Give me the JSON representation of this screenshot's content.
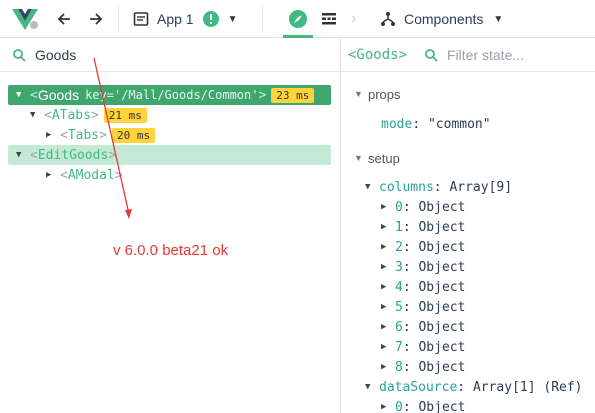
{
  "toolbar": {
    "app_label": "App 1",
    "components_label": "Components"
  },
  "tree": {
    "search_value": "Goods",
    "nodes": [
      {
        "name": "Goods",
        "attr": "key='/Mall/Goods/Common'",
        "time": "23 ms"
      },
      {
        "name": "ATabs",
        "time": "21 ms"
      },
      {
        "name": "Tabs",
        "time": "20 ms"
      },
      {
        "name": "EditGoods"
      },
      {
        "name": "AModal"
      }
    ]
  },
  "inspector": {
    "component_name": "<Goods>",
    "filter_placeholder": "Filter state...",
    "props_label": "props",
    "prop_mode_key": "mode",
    "prop_mode_value": "\"common\"",
    "setup_label": "setup",
    "columns_key": "columns",
    "columns_value": "Array[9]",
    "columns_items": [
      {
        "key": "0",
        "value": "Object"
      },
      {
        "key": "1",
        "value": "Object"
      },
      {
        "key": "2",
        "value": "Object"
      },
      {
        "key": "3",
        "value": "Object"
      },
      {
        "key": "4",
        "value": "Object"
      },
      {
        "key": "5",
        "value": "Object"
      },
      {
        "key": "6",
        "value": "Object"
      },
      {
        "key": "7",
        "value": "Object"
      },
      {
        "key": "8",
        "value": "Object"
      }
    ],
    "datasource_key": "dataSource",
    "datasource_value": "Array[1] (Ref)",
    "datasource_items": [
      {
        "key": "0",
        "value": "Object"
      }
    ]
  },
  "annotation": {
    "text": "v 6.0.0 beta21 ok",
    "color": "#e53935"
  },
  "colors": {
    "vue_green": "#42b883",
    "selected_bg": "#3fa76e",
    "highlight_bg": "#c3ead4",
    "badge": "#ffd43b"
  }
}
